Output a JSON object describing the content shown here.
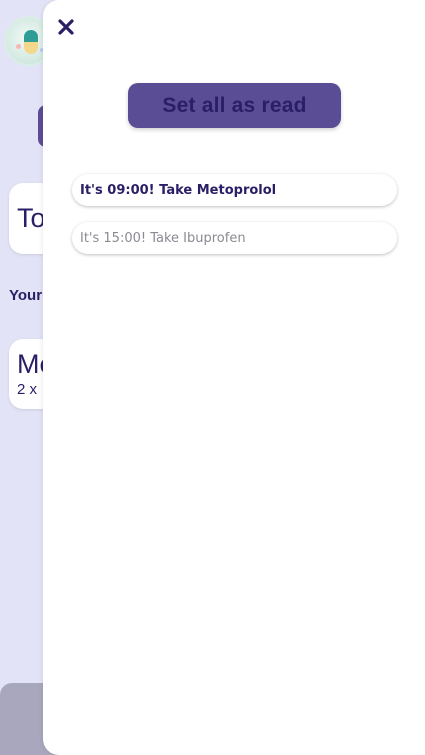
{
  "app": {
    "logo_icon": "pill-bottle-icon"
  },
  "background": {
    "today_card": {
      "title": "To"
    },
    "section_heading": "Your",
    "medication_card": {
      "name": "Me",
      "dose": "2 x"
    }
  },
  "drawer": {
    "close_icon": "close-icon",
    "set_all_read_label": "Set all as read",
    "notifications": [
      {
        "text": "It's 09:00! Take Metoprolol",
        "state": "unread"
      },
      {
        "text": "It's 15:00! Take Ibuprofen",
        "state": "read"
      }
    ]
  },
  "colors": {
    "background": "#e3e3f7",
    "primary": "#5b4c96",
    "text_dark": "#2a1f66",
    "text_read": "#8a8a93"
  }
}
